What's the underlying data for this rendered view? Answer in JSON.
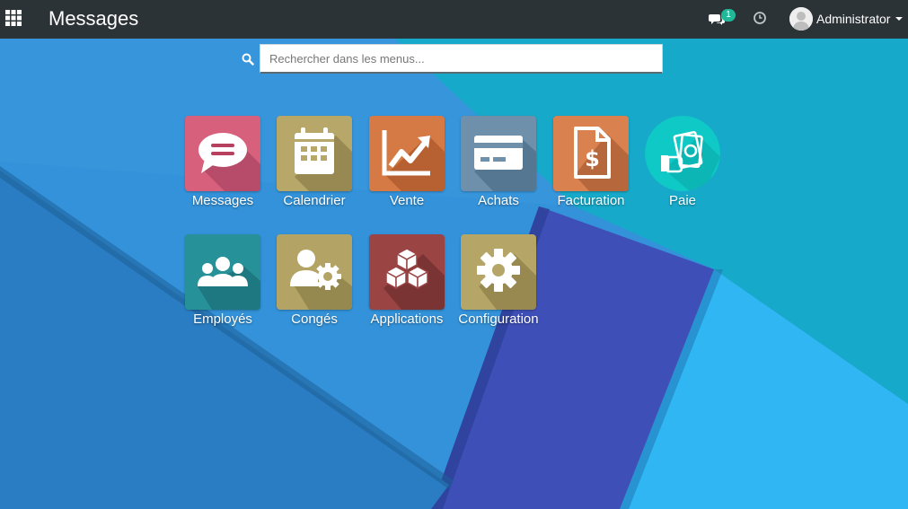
{
  "navbar": {
    "title": "Messages",
    "chat_count": "1",
    "user_name": "Administrator"
  },
  "search": {
    "placeholder": "Rechercher dans les menus..."
  },
  "apps": [
    {
      "label": "Messages",
      "icon": "chat-icon",
      "color": "#d7607c"
    },
    {
      "label": "Calendrier",
      "icon": "calendar-icon",
      "color": "#b7a86a"
    },
    {
      "label": "Vente",
      "icon": "trend-chart-icon",
      "color": "#d57a45"
    },
    {
      "label": "Achats",
      "icon": "credit-card-icon",
      "color": "#6f90ab"
    },
    {
      "label": "Facturation",
      "icon": "invoice-icon",
      "color": "#d9814f"
    },
    {
      "label": "Paie",
      "icon": "cash-hand-icon",
      "color": "#0fc9c6"
    },
    {
      "label": "Employés",
      "icon": "people-icon",
      "color": "#27919a"
    },
    {
      "label": "Congés",
      "icon": "user-gear-icon",
      "color": "#b3a466"
    },
    {
      "label": "Applications",
      "icon": "cubes-icon",
      "color": "#9a4444"
    },
    {
      "label": "Configuration",
      "icon": "gear-icon",
      "color": "#b5a667"
    }
  ],
  "colors": {
    "navbar": "#2c3336",
    "badge": "#21b799",
    "bg_light": "#35b7f2",
    "bg_teal": "#1aa8c8",
    "bg_dark": "#2a7fc4",
    "bg_band": "#3f53b9"
  }
}
